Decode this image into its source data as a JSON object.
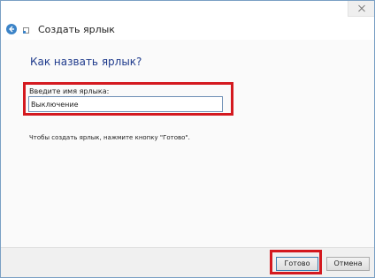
{
  "wizard": {
    "title": "Создать ярлык"
  },
  "content": {
    "heading": "Как назвать ярлык?",
    "name_label": "Введите имя ярлыка:",
    "name_value": "Выключение",
    "hint": "Чтобы создать ярлык, нажмите кнопку \"Готово\"."
  },
  "footer": {
    "done_label": "Готово",
    "cancel_label": "Отмена"
  },
  "colors": {
    "accent": "#3c84c8",
    "heading": "#1e3a8c",
    "highlight": "#d4191f"
  }
}
